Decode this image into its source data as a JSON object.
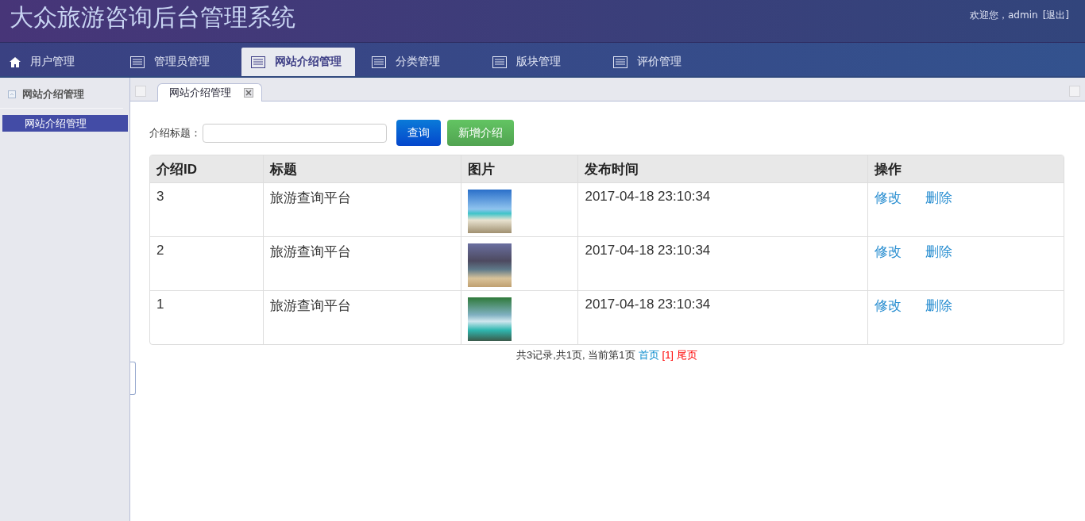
{
  "header": {
    "title": "大众旅游咨询后台管理系统",
    "welcome": "欢迎您，admin",
    "logout": "[退出]"
  },
  "nav": [
    {
      "label": "用户管理",
      "kind": "home",
      "selected": false
    },
    {
      "label": "管理员管理",
      "kind": "list",
      "selected": false
    },
    {
      "label": "网站介绍管理",
      "kind": "list",
      "selected": true
    },
    {
      "label": "分类管理",
      "kind": "list",
      "selected": false
    },
    {
      "label": "版块管理",
      "kind": "list",
      "selected": false
    },
    {
      "label": "评价管理",
      "kind": "list",
      "selected": false
    }
  ],
  "sidebar": {
    "title": "网站介绍管理",
    "items": [
      {
        "label": "网站介绍管理",
        "selected": true
      }
    ]
  },
  "tabs": [
    {
      "label": "网站介绍管理",
      "selected": true
    }
  ],
  "search": {
    "label": "介绍标题：",
    "query_button": "查询",
    "add_button": "新增介绍"
  },
  "table": {
    "columns": [
      "介绍ID",
      "标题",
      "图片",
      "发布时间",
      "操作"
    ],
    "rows": [
      {
        "id": "3",
        "title": "旅游查询平台",
        "time": "2017-04-18 23:10:34",
        "actions": [
          "修改",
          "删除"
        ]
      },
      {
        "id": "2",
        "title": "旅游查询平台",
        "time": "2017-04-18 23:10:34",
        "actions": [
          "修改",
          "删除"
        ]
      },
      {
        "id": "1",
        "title": "旅游查询平台",
        "time": "2017-04-18 23:10:34",
        "actions": [
          "修改",
          "删除"
        ]
      }
    ]
  },
  "pager": {
    "summary": "共3记录,共1页, 当前第1页",
    "links": [
      {
        "label": "首页",
        "highlighted": false
      },
      {
        "label": "[1]",
        "highlighted": true
      },
      {
        "label": "尾页",
        "highlighted": true
      }
    ]
  }
}
